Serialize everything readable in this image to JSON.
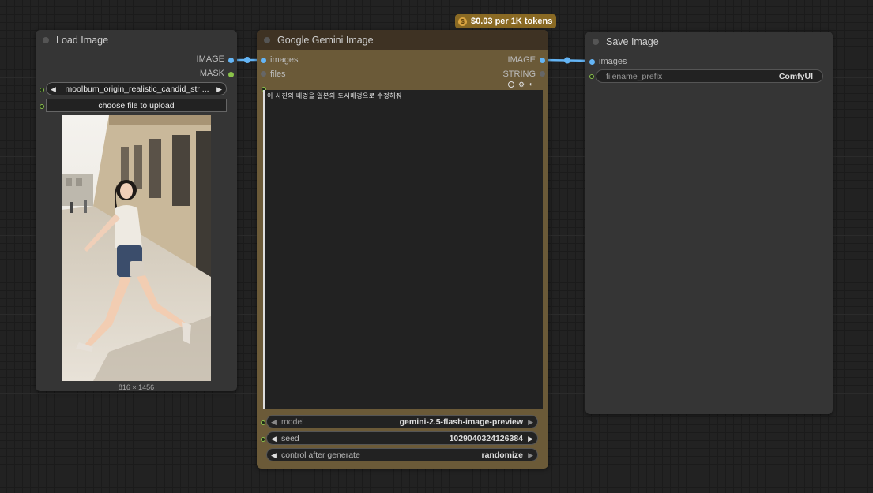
{
  "pricing_badge": "$0.03 per 1K tokens",
  "pricing_icon": "$",
  "load_image": {
    "title": "Load Image",
    "outputs": [
      "IMAGE",
      "MASK"
    ],
    "image_widget": "moolbum_origin_realistic_candid_str ...",
    "upload_button": "choose file to upload",
    "dimensions": "816 × 1456"
  },
  "gemini": {
    "title": "Google Gemini Image",
    "inputs": [
      "images",
      "files"
    ],
    "outputs": [
      "IMAGE",
      "STRING"
    ],
    "prompt": "이 사진의 배경을 일본의 도시배경으로 수정해줘",
    "model_label": "model",
    "model_value": "gemini-2.5-flash-image-preview",
    "seed_label": "seed",
    "seed_value": "1029040324126384",
    "control_label": "control after generate",
    "control_value": "randomize"
  },
  "save_image": {
    "title": "Save Image",
    "input": "images",
    "prefix_label": "filename_prefix",
    "prefix_value": "ComfyUI"
  },
  "colors": {
    "canvas": "#222222",
    "node_bg": "#353535",
    "gemini_title": "#3e3223",
    "gemini_body": "#6b5a38",
    "link_blue": "#64b5f6",
    "badge": "#8a6a24"
  }
}
